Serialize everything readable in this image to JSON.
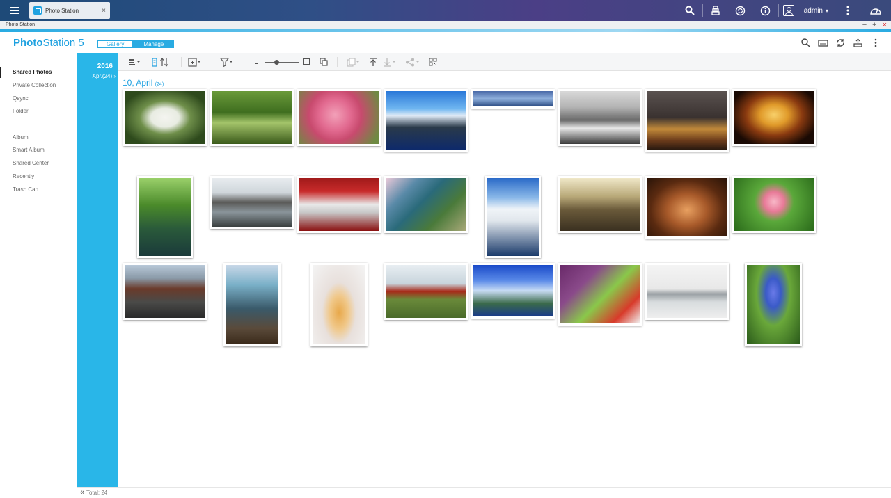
{
  "os_bar": {
    "tab_title": "Photo Station",
    "tab_close": "×",
    "user": "admin",
    "user_caret": "▾"
  },
  "window": {
    "title": "Photo Station",
    "minimize": "−",
    "maximize": "+",
    "close": "×"
  },
  "header": {
    "logo_bold": "Photo",
    "logo_rest": "Station 5",
    "modes": [
      "Gallery",
      "Manage"
    ],
    "active_mode": "Manage"
  },
  "sidebar": {
    "items": [
      "Shared Photos",
      "Private Collection",
      "Qsync",
      "Folder",
      "Album",
      "Smart Album",
      "Shared Center",
      "Recently",
      "Trash Can"
    ],
    "active": "Shared Photos"
  },
  "timeline": {
    "year": "2016",
    "month": "Apr.(24) ›"
  },
  "group": {
    "date": "10, April",
    "count": "(24)"
  },
  "footer": {
    "total": "Total: 24",
    "collapse": "«"
  },
  "colors": {
    "accent": "#29b6e8",
    "title_blue": "#1ea1e0",
    "close_red": "#d9252a"
  },
  "photo_subjects": [
    "white-flower",
    "green-trees-reflection",
    "pink-blossoms",
    "overwater-bungalows",
    "ocean-horizon",
    "waves-on-rocks",
    "rainy-window-city",
    "carousel-night",
    "forest-stream",
    "canal-warehouses",
    "race-car",
    "heart-shaped-reef",
    "yacht-harbor",
    "street-sunset",
    "plated-food",
    "pink-rose",
    "brick-warehouses-canal",
    "long-exposure-rocks",
    "ice-cream-cone",
    "red-tractor-field",
    "blue-sky-cliffs",
    "grilled-vegetables",
    "misty-pier",
    "blue-agapanthus"
  ]
}
